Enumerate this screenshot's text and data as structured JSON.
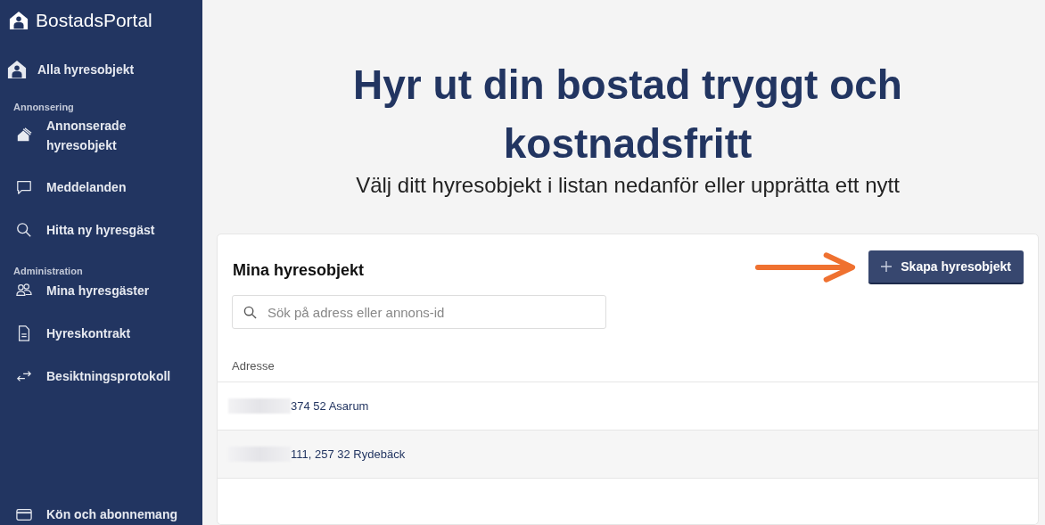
{
  "brand": {
    "name": "BostadsPortal"
  },
  "sidebar": {
    "top_item": {
      "label": "Alla hyresobjekt"
    },
    "sections": [
      {
        "heading": "Annonsering",
        "items": [
          {
            "label": "Annonserade hyresobjekt",
            "kind": "houses"
          },
          {
            "label": "Meddelanden",
            "kind": "chat"
          },
          {
            "label": "Hitta ny hyresgäst",
            "kind": "search"
          }
        ]
      },
      {
        "heading": "Administration",
        "items": [
          {
            "label": "Mina hyresgäster",
            "kind": "people"
          },
          {
            "label": "Hyreskontrakt",
            "kind": "document"
          },
          {
            "label": "Besiktningsprotokoll",
            "kind": "arrows"
          }
        ]
      }
    ],
    "bottom_item": {
      "label": "Kön och abonnemang",
      "kind": "card"
    }
  },
  "hero": {
    "title": "Hyr ut din bostad tryggt och kostnadsfritt",
    "subtitle": "Välj ditt hyresobjekt i listan nedanför eller upprätta ett nytt"
  },
  "panel": {
    "title": "Mina hyresobjekt",
    "create_button": "Skapa hyresobjekt",
    "search": {
      "placeholder": "Sök på adress eller annons-id"
    },
    "table": {
      "columns": [
        "Adresse"
      ],
      "rows": [
        {
          "address": "374 52 Asarum"
        },
        {
          "address": "111, 257 32 Rydebäck"
        }
      ]
    }
  }
}
